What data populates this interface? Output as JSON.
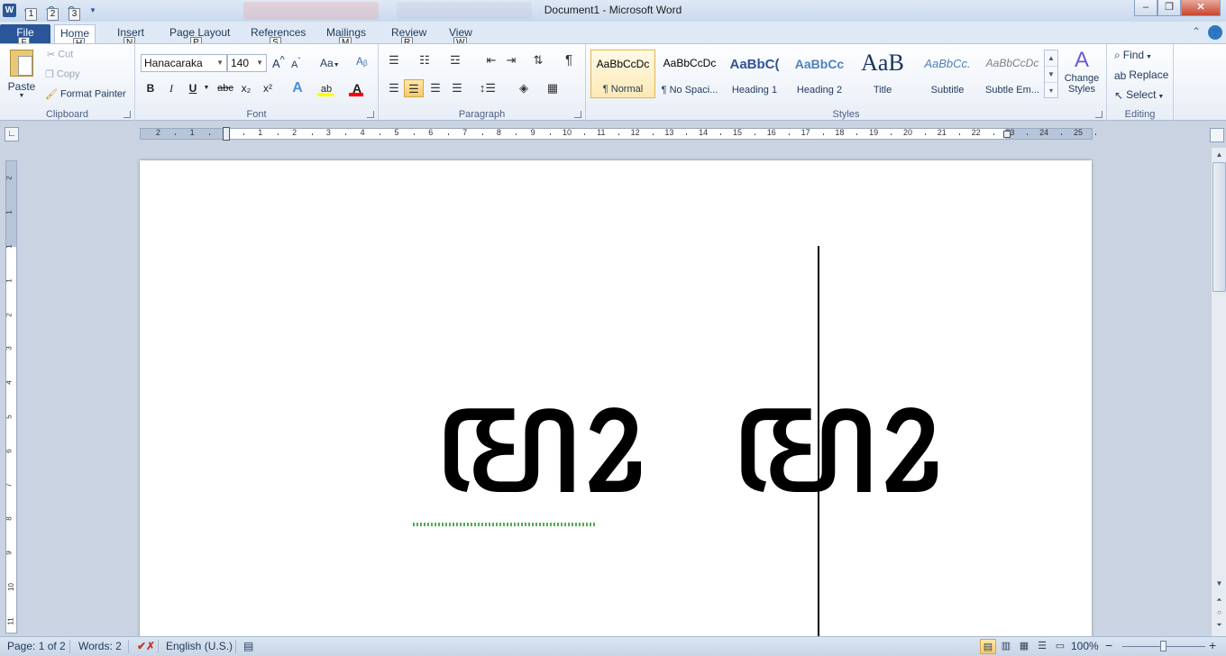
{
  "window": {
    "title": "Document1 - Microsoft Word",
    "app_icon_letter": "W",
    "controls": {
      "minimize": "–",
      "maximize": "❐",
      "close": "✕"
    }
  },
  "quick_access": {
    "keytips": [
      "1",
      "2",
      "3"
    ]
  },
  "tabs": [
    {
      "label": "File",
      "keytip": "F"
    },
    {
      "label": "Home",
      "keytip": "H"
    },
    {
      "label": "Insert",
      "keytip": "N"
    },
    {
      "label": "Page Layout",
      "keytip": "P"
    },
    {
      "label": "References",
      "keytip": "S"
    },
    {
      "label": "Mailings",
      "keytip": "M"
    },
    {
      "label": "Review",
      "keytip": "R"
    },
    {
      "label": "View",
      "keytip": "W"
    }
  ],
  "help_label": "?",
  "ribbon": {
    "clipboard": {
      "label": "Clipboard",
      "paste": "Paste",
      "cut": "Cut",
      "copy": "Copy",
      "format_painter": "Format Painter"
    },
    "font": {
      "label": "Font",
      "font_name": "Hanacaraka",
      "font_size": "140",
      "change_case": "Aa",
      "bold": "B",
      "italic": "I",
      "underline": "U",
      "strikethrough": "abc",
      "subscript": "x₂",
      "superscript": "x²"
    },
    "paragraph": {
      "label": "Paragraph"
    },
    "styles": {
      "label": "Styles",
      "items": [
        {
          "sample": "AaBbCcDc",
          "name": "¶ Normal"
        },
        {
          "sample": "AaBbCcDc",
          "name": "¶ No Spaci..."
        },
        {
          "sample": "AaBbC(",
          "name": "Heading 1"
        },
        {
          "sample": "AaBbCc",
          "name": "Heading 2"
        },
        {
          "sample": "AaB",
          "name": "Title"
        },
        {
          "sample": "AaBbCc.",
          "name": "Subtitle"
        },
        {
          "sample": "AaBbCcDc",
          "name": "Subtle Em..."
        }
      ],
      "change_styles": "Change Styles"
    },
    "editing": {
      "label": "Editing",
      "find": "Find",
      "replace": "Replace",
      "select": "Select"
    }
  },
  "ruler": {
    "h_numbers": [
      "2",
      "1",
      "1",
      "1",
      "2",
      "3",
      "4",
      "5",
      "6",
      "7",
      "8",
      "9",
      "10",
      "11",
      "12",
      "13",
      "14",
      "15",
      "16",
      "17",
      "18",
      "19",
      "20",
      "21",
      "22",
      "23",
      "24",
      "25"
    ],
    "v_numbers": [
      "2",
      "1",
      "1",
      "1",
      "2",
      "3",
      "4",
      "5",
      "6",
      "7",
      "8",
      "9",
      "10",
      "11"
    ]
  },
  "document": {
    "text": "ꦩꦴ ꦩꦴ"
  },
  "status": {
    "page": "Page: 1 of 2",
    "words": "Words: 2",
    "language": "English (U.S.)",
    "zoom": "100%",
    "zoom_out": "−",
    "zoom_in": "+"
  },
  "colors": {
    "accent": "#2a5699",
    "highlight": "#ffff00",
    "font_color": "#ff0000"
  }
}
